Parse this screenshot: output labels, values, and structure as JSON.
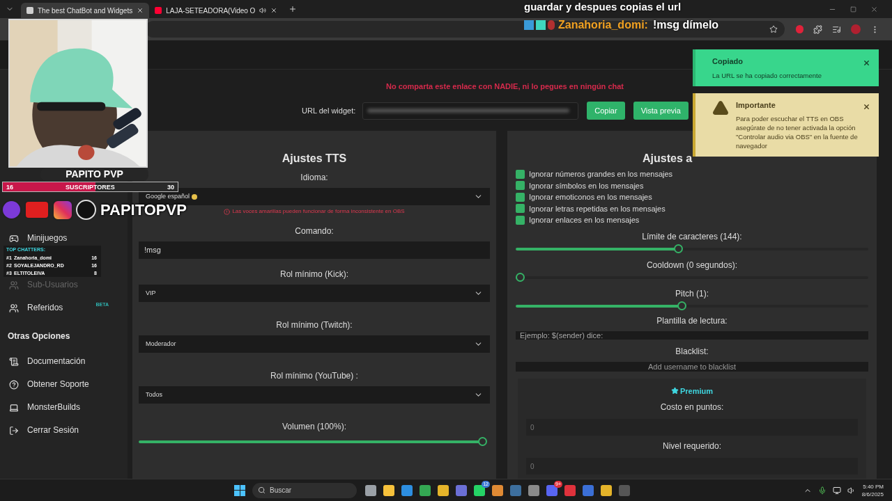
{
  "browser": {
    "tabs": [
      {
        "title": "The best ChatBot and Widgets",
        "selected": true,
        "audio": false
      },
      {
        "title": "LAJA-SETEADORA(Video O",
        "selected": false,
        "audio": true
      }
    ]
  },
  "stream_overlay": {
    "channel_name": "PAPITO PVP",
    "subscribers": {
      "current": "16",
      "label": "SUSCRIPTORES",
      "goal": "30",
      "level": 0.53
    },
    "handle": "PAPITOPVP",
    "top_chatters": {
      "title": "TOP CHATTERS:",
      "rows": [
        {
          "rank": "#1",
          "name": "Zanahoria_domi",
          "count": "16"
        },
        {
          "rank": "#2",
          "name": "SOYALEJANDRO_RD",
          "count": "16"
        },
        {
          "rank": "#3",
          "name": "ELTITOLEIVA",
          "count": "8"
        }
      ]
    },
    "chat": {
      "previous_line": "guardar y despues copias el url",
      "user": "Zanahoria_domi:",
      "message": "!msg dímelo"
    }
  },
  "sidebar": {
    "items": [
      {
        "kind": "item",
        "label": "Minijuegos",
        "disabled": false
      },
      {
        "kind": "item",
        "label": "Sub-Usuarios",
        "disabled": true
      },
      {
        "kind": "item",
        "label": "Referidos",
        "disabled": false,
        "badge": "BETA"
      },
      {
        "kind": "heading",
        "label": "Otras Opciones"
      },
      {
        "kind": "item",
        "label": "Documentación",
        "disabled": false
      },
      {
        "kind": "item",
        "label": "Obtener Soporte",
        "disabled": false
      },
      {
        "kind": "item",
        "label": "MonsterBuilds",
        "disabled": false
      },
      {
        "kind": "item",
        "label": "Cerrar Sesión",
        "disabled": false
      }
    ]
  },
  "warning": "No comparta este enlace con NADIE, ni lo pegues en ningún chat",
  "url_row": {
    "label": "URL del widget:",
    "buttons": [
      "Copiar",
      "Vista previa"
    ]
  },
  "tts_settings": {
    "title": "Ajustes TTS",
    "fields": [
      {
        "kind": "select",
        "label": "Idioma:",
        "value": "Google español",
        "note": "Las voces amarillas pueden funcionar de forma inconsistente en OBS"
      },
      {
        "kind": "input",
        "label": "Comando:",
        "value": "!msg"
      },
      {
        "kind": "select",
        "label": "Rol mínimo (Kick):",
        "value": "VIP"
      },
      {
        "kind": "select",
        "label": "Rol mínimo (Twitch):",
        "value": "Moderador"
      },
      {
        "kind": "select",
        "label": "Rol mínimo (YouTube) :",
        "value": "Todos"
      },
      {
        "kind": "slider",
        "label": "Volumen (100%):",
        "level": 1
      }
    ]
  },
  "advanced_settings": {
    "title": "Ajustes a",
    "options": [
      {
        "label": "Ignorar números grandes en los mensajes",
        "checked": true
      },
      {
        "label": "Ignorar símbolos en los mensajes",
        "checked": true
      },
      {
        "label": "Ignorar emoticonos en los mensajes",
        "checked": true
      },
      {
        "label": "Ignorar letras repetidas en los mensajes",
        "checked": true
      },
      {
        "label": "Ignorar enlaces en los mensajes",
        "checked": true
      }
    ],
    "sliders": [
      {
        "label": "Límite de caracteres (144):",
        "level": 0.46
      },
      {
        "label": "Cooldown (0 segundos):",
        "level": 0
      },
      {
        "label": "Pitch (1):",
        "level": 0.47
      }
    ],
    "template": {
      "label": "Plantilla de lectura:",
      "placeholder": "Ejemplo: $(sender) dice:"
    },
    "blacklist": {
      "label": "Blacklist:",
      "placeholder": "Add username to blacklist"
    },
    "premium": {
      "title": "Premium",
      "fields": [
        {
          "label": "Costo en puntos:",
          "placeholder": "0"
        },
        {
          "label": "Nivel requerido:",
          "placeholder": "0"
        }
      ]
    }
  },
  "toasts": [
    {
      "kind": "success",
      "title": "Copiado",
      "message": "La URL se ha copiado correctamente"
    },
    {
      "kind": "warning",
      "title": "Importante",
      "message": "Para poder escuchar el TTS en OBS asegúrate de no tener activada la opción \"Controlar audio via OBS\" en la fuente de navegador"
    }
  ],
  "taskbar": {
    "search_placeholder": "Buscar",
    "badges": {
      "whatsapp": "12",
      "discord": "9+"
    },
    "time": "5:40 PM",
    "date": "8/6/2025"
  }
}
